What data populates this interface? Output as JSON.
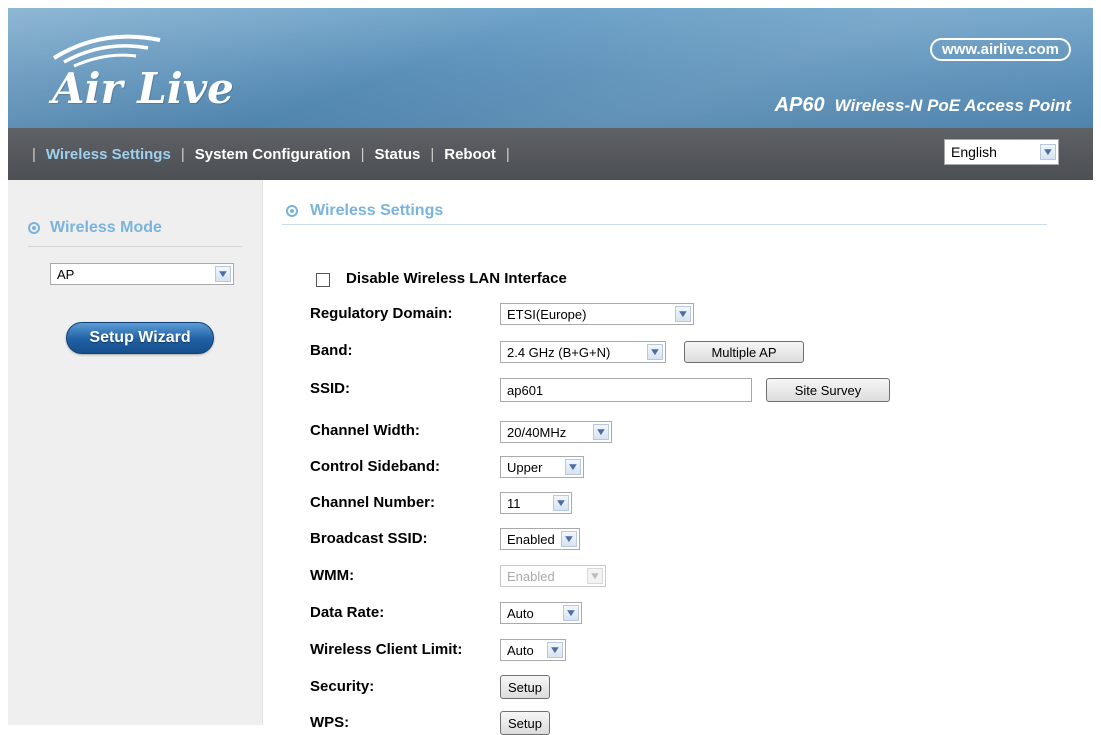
{
  "header": {
    "logo_text": "Air Live",
    "url": "www.airlive.com",
    "model": "AP60",
    "product_name": "Wireless-N PoE Access Point"
  },
  "nav": {
    "items": [
      "Wireless Settings",
      "System Configuration",
      "Status",
      "Reboot"
    ],
    "active": "Wireless Settings",
    "language": "English"
  },
  "sidebar": {
    "title": "Wireless Mode",
    "mode_value": "AP",
    "wizard_label": "Setup Wizard"
  },
  "main": {
    "title": "Wireless Settings",
    "disable_label": "Disable Wireless LAN Interface",
    "fields": {
      "regulatory_domain": {
        "label": "Regulatory Domain:",
        "value": "ETSI(Europe)"
      },
      "band": {
        "label": "Band:",
        "value": "2.4 GHz (B+G+N)"
      },
      "multiple_ap": "Multiple AP",
      "ssid": {
        "label": "SSID:",
        "value": "ap601"
      },
      "site_survey": "Site Survey",
      "channel_width": {
        "label": "Channel Width:",
        "value": "20/40MHz"
      },
      "control_sideband": {
        "label": "Control Sideband:",
        "value": "Upper"
      },
      "channel_number": {
        "label": "Channel Number:",
        "value": "11"
      },
      "broadcast_ssid": {
        "label": "Broadcast SSID:",
        "value": "Enabled"
      },
      "wmm": {
        "label": "WMM:",
        "value": "Enabled"
      },
      "data_rate": {
        "label": "Data Rate:",
        "value": "Auto"
      },
      "client_limit": {
        "label": "Wireless Client Limit:",
        "value": "Auto"
      },
      "security": {
        "label": "Security:",
        "button": "Setup"
      },
      "wps": {
        "label": "WPS:",
        "button": "Setup"
      }
    }
  }
}
